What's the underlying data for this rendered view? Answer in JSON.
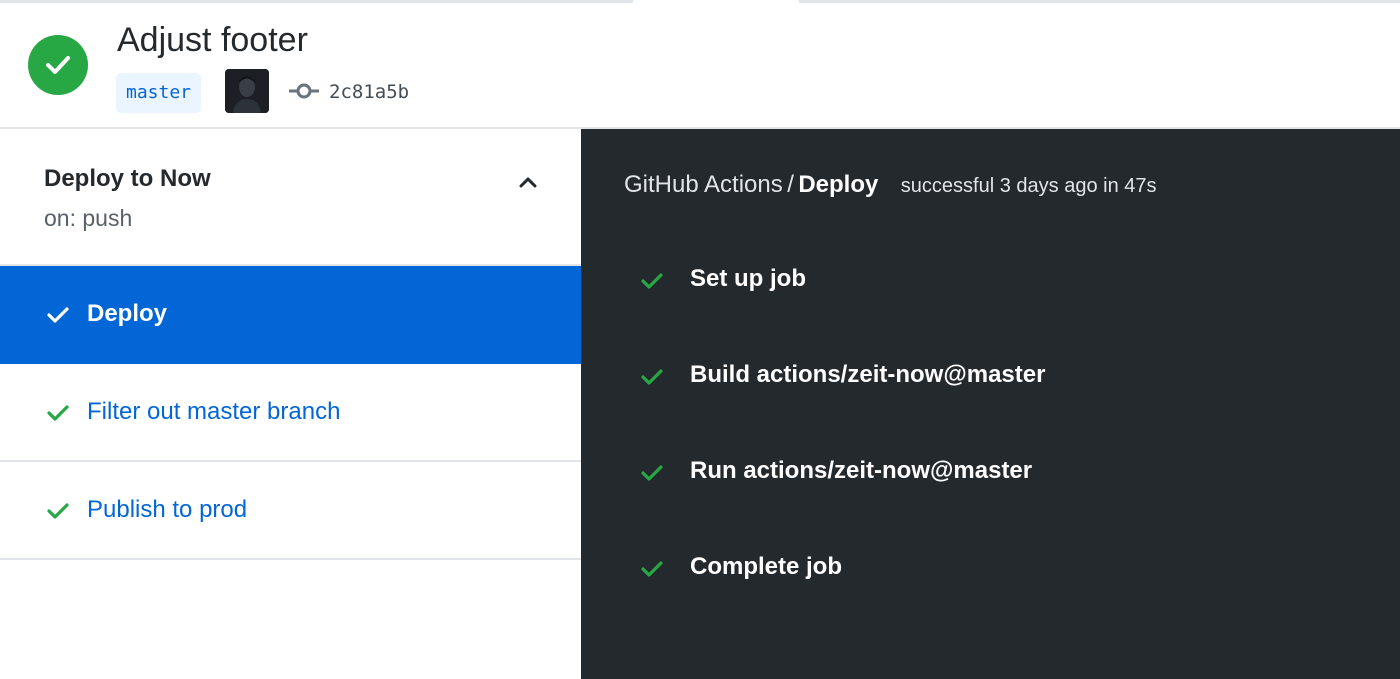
{
  "run": {
    "title": "Adjust footer",
    "branch": "master",
    "commit_sha": "2c81a5b",
    "status_icon": "check-circle-icon",
    "status_color": "#28a745"
  },
  "workflow": {
    "name": "Deploy to Now",
    "trigger": "on: push",
    "jobs": [
      {
        "label": "Deploy",
        "active": true
      },
      {
        "label": "Filter out master branch",
        "active": false
      },
      {
        "label": "Publish to prod",
        "active": false
      }
    ]
  },
  "job_detail": {
    "app_name": "GitHub Actions",
    "separator": "/",
    "job_name": "Deploy",
    "meta": "successful 3 days ago in 47s",
    "steps": [
      {
        "label": "Set up job"
      },
      {
        "label": "Build actions/zeit-now@master"
      },
      {
        "label": "Run actions/zeit-now@master"
      },
      {
        "label": "Complete job"
      }
    ]
  },
  "colors": {
    "accent_blue": "#0366d6",
    "success_green": "#28a745",
    "dark_panel": "#24292e"
  }
}
